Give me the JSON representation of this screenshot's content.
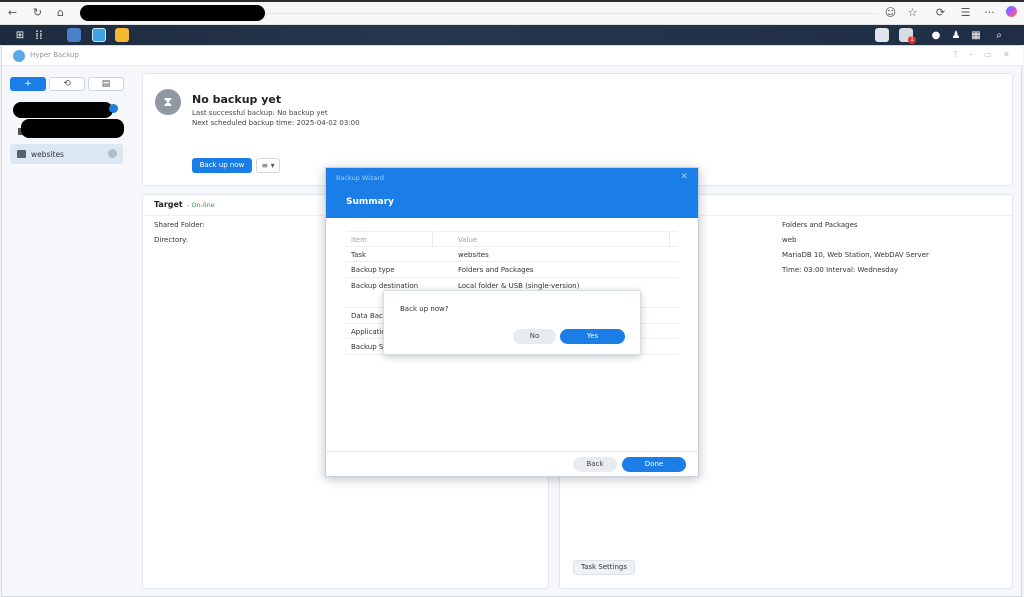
{
  "browser": {
    "back_icon": "arrow-left-icon",
    "reload_icon": "reload-icon",
    "home_icon": "home-icon",
    "icons_right": [
      "reader-icon",
      "favorite-icon",
      "extensions-icon",
      "collections-icon",
      "more-icon",
      "copilot-icon"
    ],
    "more_label": "···"
  },
  "taskbar": {
    "main_menu_icon": "grid-icon",
    "notification_count": "1"
  },
  "app": {
    "title": "Hyper Backup",
    "window_controls": [
      "?",
      "–",
      "▭",
      "✕"
    ]
  },
  "sidebar": {
    "add_label": "+",
    "history_icon": "history-icon",
    "log_icon": "log-icon",
    "task_label": "websites"
  },
  "status": {
    "title": "No backup yet",
    "last_backup": "Last successful backup: No backup yet",
    "next_backup": "Next scheduled backup time: 2025-04-02 03:00",
    "backup_now_label": "Back up now",
    "menu_label": "≡ ▾"
  },
  "target": {
    "title": "Target",
    "status": "- On-line",
    "shared_folder_label": "Shared Folder:",
    "directory_label": "Directory:"
  },
  "right_panel": {
    "values": [
      "Folders and Packages",
      "web",
      "MariaDB 10, Web Station, WebDAV Server",
      "Time: 03:00 Interval: Wednesday"
    ],
    "task_settings_label": "Task Settings"
  },
  "wizard": {
    "caption": "Backup Wizard",
    "title": "Summary",
    "close_label": "✕",
    "header": {
      "item": "Item",
      "value": "Value"
    },
    "rows": [
      {
        "item": "Task",
        "value": "websites"
      },
      {
        "item": "Backup type",
        "value": "Folders and Packages"
      },
      {
        "item": "Backup destination",
        "value": "Local folder & USB (single-version)"
      },
      {
        "item": "",
        "value": ""
      },
      {
        "item": "Data Back",
        "value": ""
      },
      {
        "item": "Applicatio",
        "value": ""
      },
      {
        "item": "Backup S",
        "value": ""
      }
    ],
    "back_label": "Back",
    "done_label": "Done"
  },
  "confirm": {
    "message": "Back up now?",
    "no_label": "No",
    "yes_label": "Yes"
  },
  "colors": {
    "accent": "#1a7ee6",
    "online": "#2f9e2f",
    "taskbar": "#1f2e44"
  }
}
